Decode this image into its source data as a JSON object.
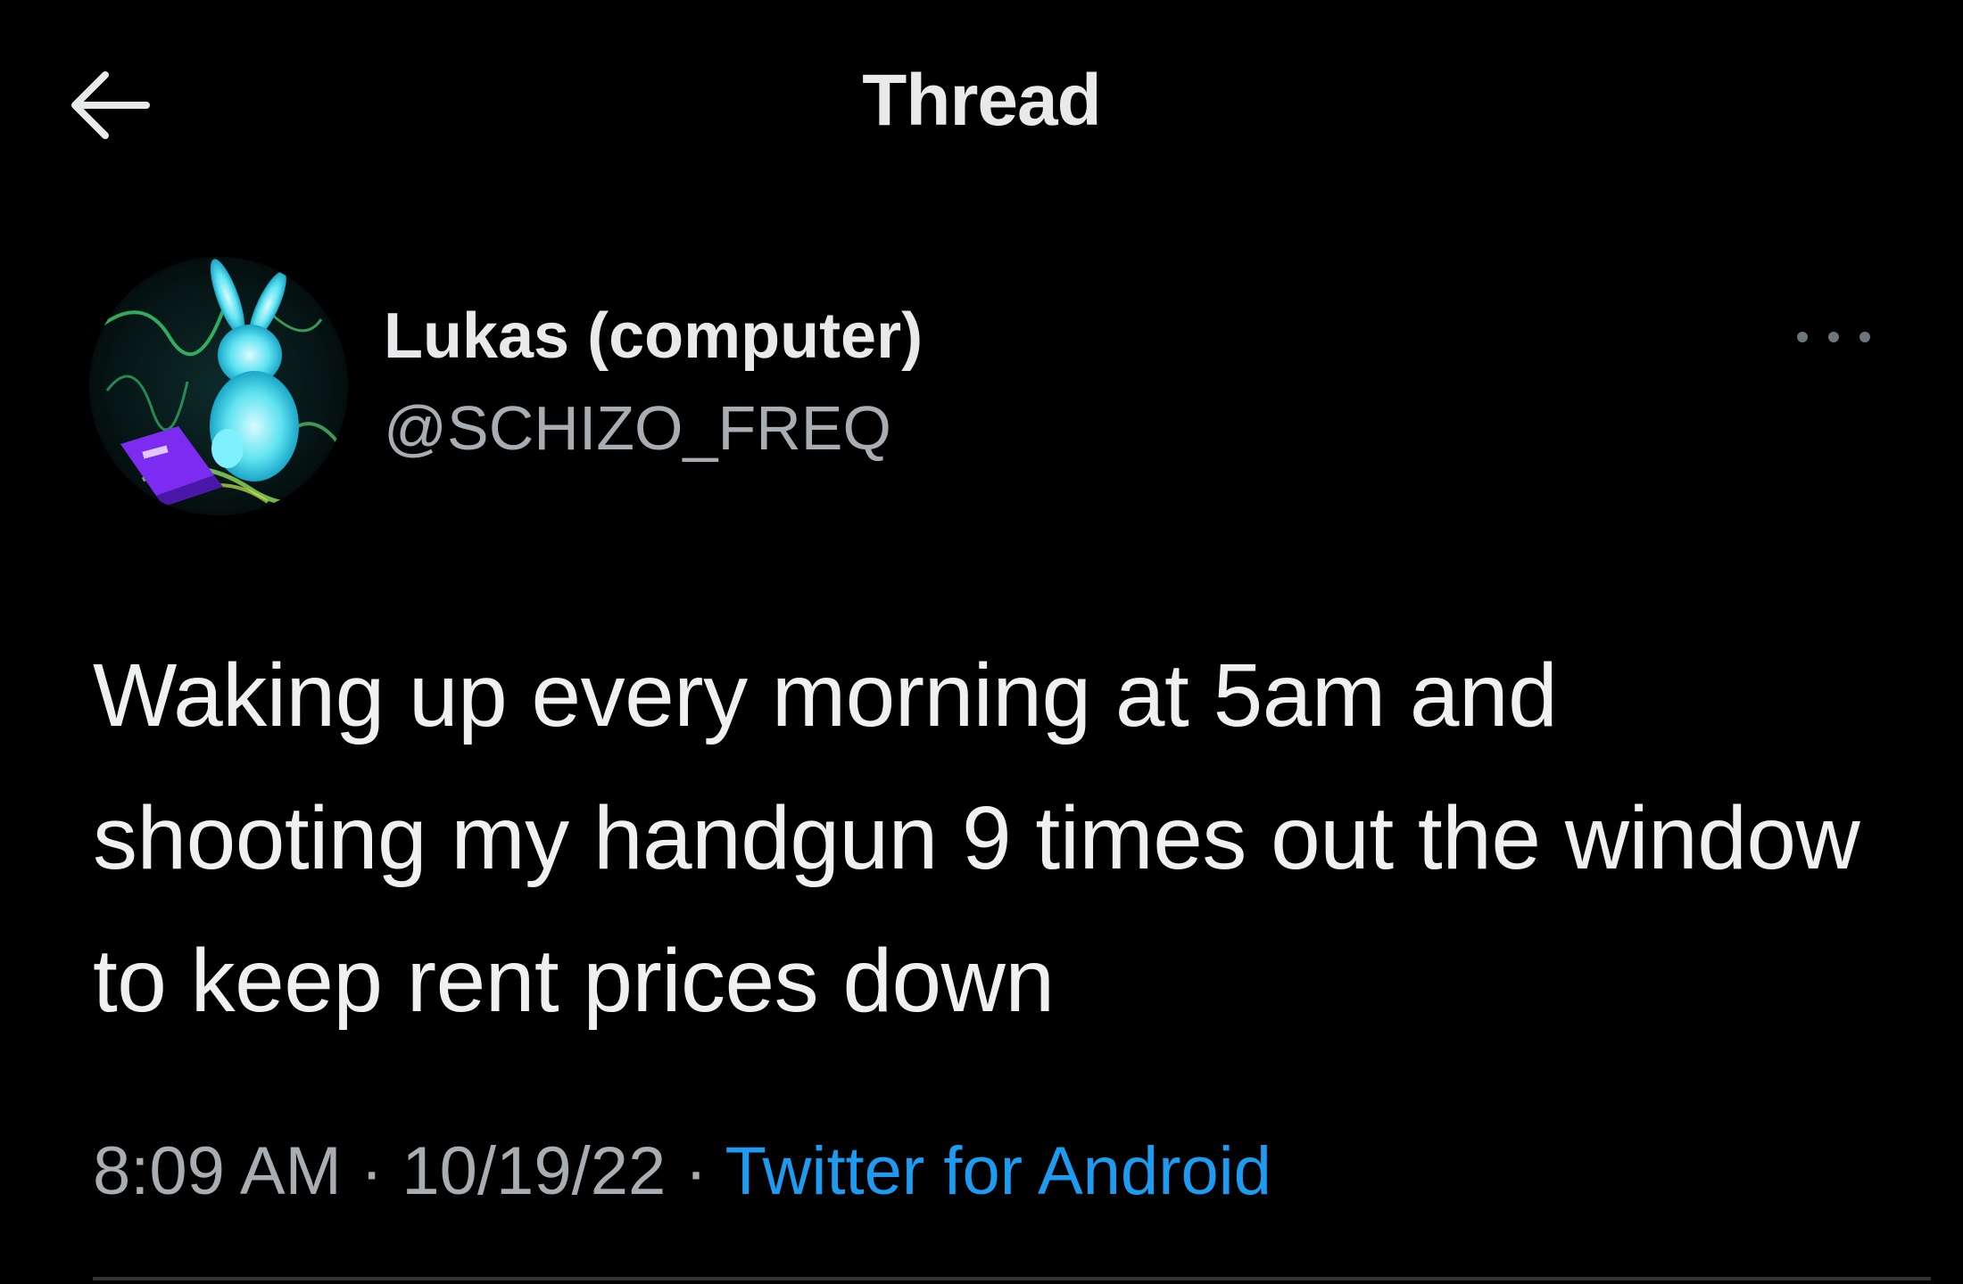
{
  "header": {
    "back_icon": "arrow-left-icon",
    "title": "Thread"
  },
  "tweet": {
    "author": {
      "display_name": "Lukas (computer)",
      "handle": "@SCHIZO_FREQ",
      "avatar_icon": "avatar-image"
    },
    "more_icon": "more-horizontal-icon",
    "text": "Waking up every morning at 5am and shooting my handgun 9 times out the window to keep rent prices down",
    "time": "8:09 AM",
    "date": "10/19/22",
    "separator": "·",
    "source": "Twitter for Android"
  },
  "colors": {
    "background": "#000000",
    "text_primary": "#e7e9ea",
    "text_secondary": "#a8adb2",
    "link": "#1d9bf0",
    "divider": "#2f3336"
  }
}
